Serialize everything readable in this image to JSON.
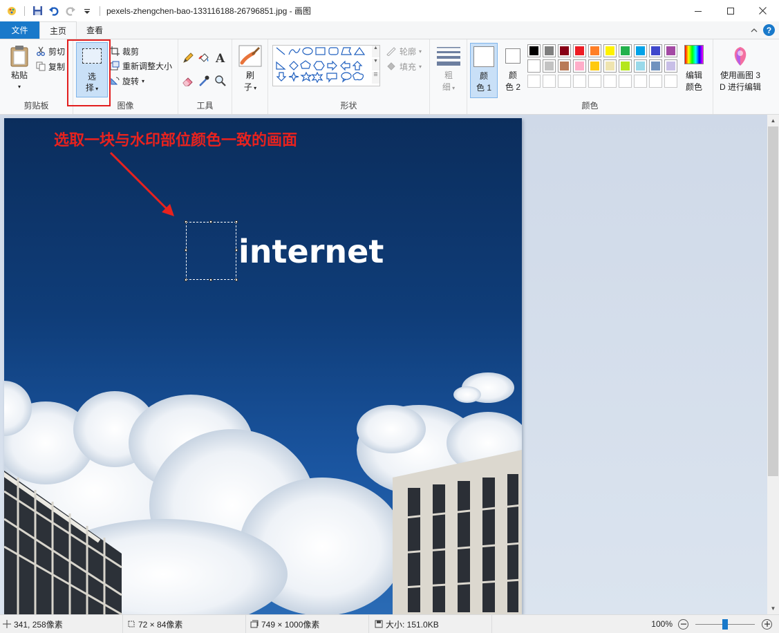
{
  "titlebar": {
    "filename": "pexels-zhengchen-bao-133116188-26796851.jpg",
    "separator": " - ",
    "app_name": "画图"
  },
  "tabs": {
    "file": "文件",
    "home": "主页",
    "view": "查看"
  },
  "ribbon": {
    "clipboard": {
      "paste": "粘贴",
      "cut": "剪切",
      "copy": "复制",
      "label": "剪贴板"
    },
    "image": {
      "select_top": "选",
      "select_bottom": "择",
      "crop": "裁剪",
      "resize": "重新调整大小",
      "rotate": "旋转",
      "label": "图像"
    },
    "tools": {
      "label": "工具"
    },
    "brushes": {
      "top": "刷",
      "bottom": "子"
    },
    "shapes": {
      "outline": "轮廓",
      "fill": "填充",
      "label": "形状"
    },
    "size": {
      "top": "粗",
      "bottom": "细"
    },
    "colors": {
      "color1_top": "颜",
      "color1_bottom": "色 1",
      "color2_top": "颜",
      "color2_bottom": "色 2",
      "edit_top": "编辑",
      "edit_bottom": "颜色",
      "label": "颜色",
      "row1": [
        "#000000",
        "#7f7f7f",
        "#880015",
        "#ed1c24",
        "#ff7f27",
        "#fff200",
        "#22b14c",
        "#00a2e8",
        "#3f48cc",
        "#a349a4"
      ],
      "row2": [
        "#ffffff",
        "#c3c3c3",
        "#b97a57",
        "#ffaec9",
        "#ffc90e",
        "#efe4b0",
        "#b5e61d",
        "#99d9ea",
        "#7092be",
        "#c8bfe7"
      ],
      "primary": "#ffffff",
      "secondary": "#ffffff"
    },
    "paint3d": {
      "top": "使用画图 3",
      "bottom": "D 进行编辑"
    }
  },
  "canvas": {
    "annotation": "选取一块与水印部位颜色一致的画面",
    "watermark": "internet"
  },
  "status": {
    "cursor": "341, 258像素",
    "selection": "72 × 84像素",
    "image_size": "749 × 1000像素",
    "file_size": "大小: 151.0KB",
    "zoom": "100%"
  },
  "colors": {
    "accent": "#1979ca",
    "highlight": "#e21d1d"
  }
}
